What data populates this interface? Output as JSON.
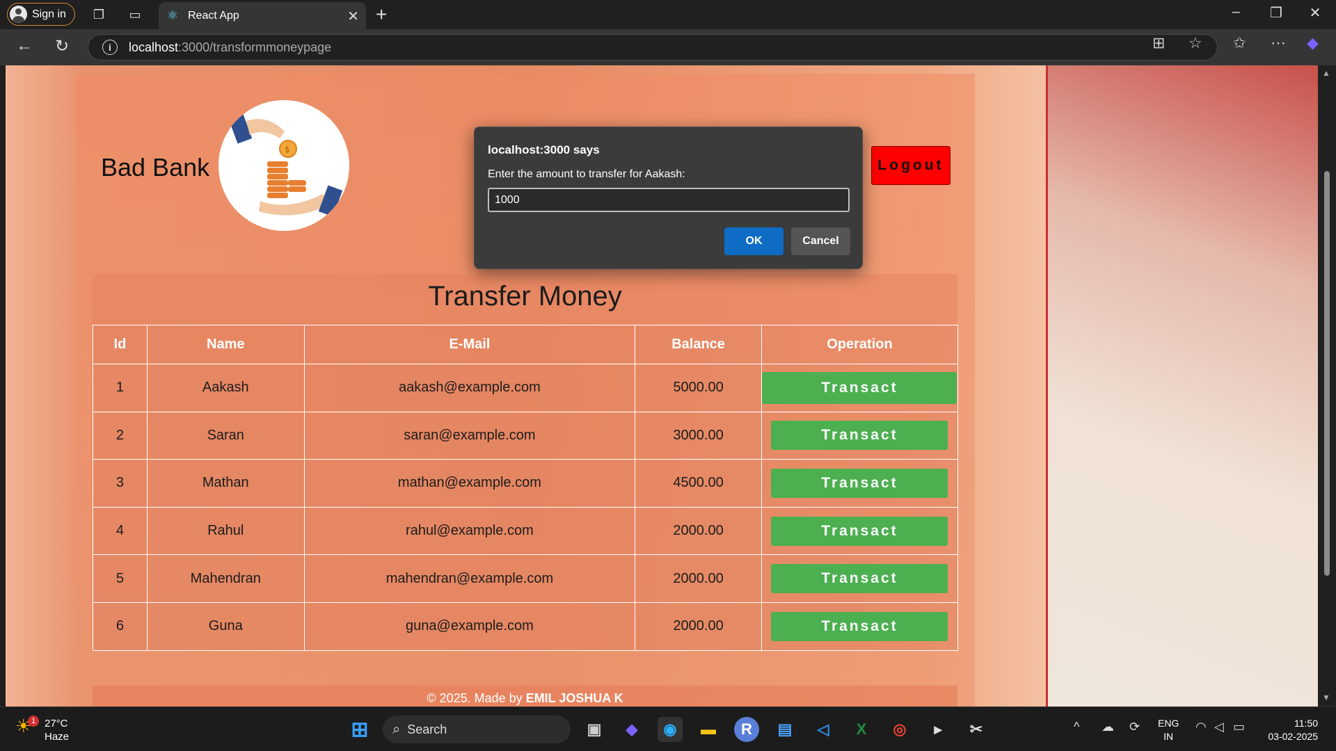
{
  "browser": {
    "signin_label": "Sign in",
    "tab_title": "React App",
    "url_host": "localhost",
    "url_path": ":3000/transformmoneypage"
  },
  "app": {
    "brand": "Bad Bank",
    "logout_label": "Logout",
    "page_title": "Transfer Money",
    "table": {
      "headers": [
        "Id",
        "Name",
        "E-Mail",
        "Balance",
        "Operation"
      ],
      "rows": [
        {
          "id": "1",
          "name": "Aakash",
          "email": "aakash@example.com",
          "balance": "5000.00",
          "action": "Transact"
        },
        {
          "id": "2",
          "name": "Saran",
          "email": "saran@example.com",
          "balance": "3000.00",
          "action": "Transact"
        },
        {
          "id": "3",
          "name": "Mathan",
          "email": "mathan@example.com",
          "balance": "4500.00",
          "action": "Transact"
        },
        {
          "id": "4",
          "name": "Rahul",
          "email": "rahul@example.com",
          "balance": "2000.00",
          "action": "Transact"
        },
        {
          "id": "5",
          "name": "Mahendran",
          "email": "mahendran@example.com",
          "balance": "2000.00",
          "action": "Transact"
        },
        {
          "id": "6",
          "name": "Guna",
          "email": "guna@example.com",
          "balance": "2000.00",
          "action": "Transact"
        }
      ]
    },
    "footer_prefix": "© 2025. Made by ",
    "footer_author": "EMIL JOSHUA K"
  },
  "dialog": {
    "title": "localhost:3000 says",
    "message": "Enter the amount to transfer for Aakash:",
    "input_value": "1000",
    "ok_label": "OK",
    "cancel_label": "Cancel"
  },
  "taskbar": {
    "weather_temp": "27°C",
    "weather_desc": "Haze",
    "weather_badge": "1",
    "search_placeholder": "Search",
    "lang_line1": "ENG",
    "lang_line2": "IN",
    "time": "11:50",
    "date": "03-02-2025"
  },
  "colors": {
    "transact_green": "#4caf50",
    "logout_red": "#ff0000",
    "dialog_ok_blue": "#0e6cc4"
  }
}
